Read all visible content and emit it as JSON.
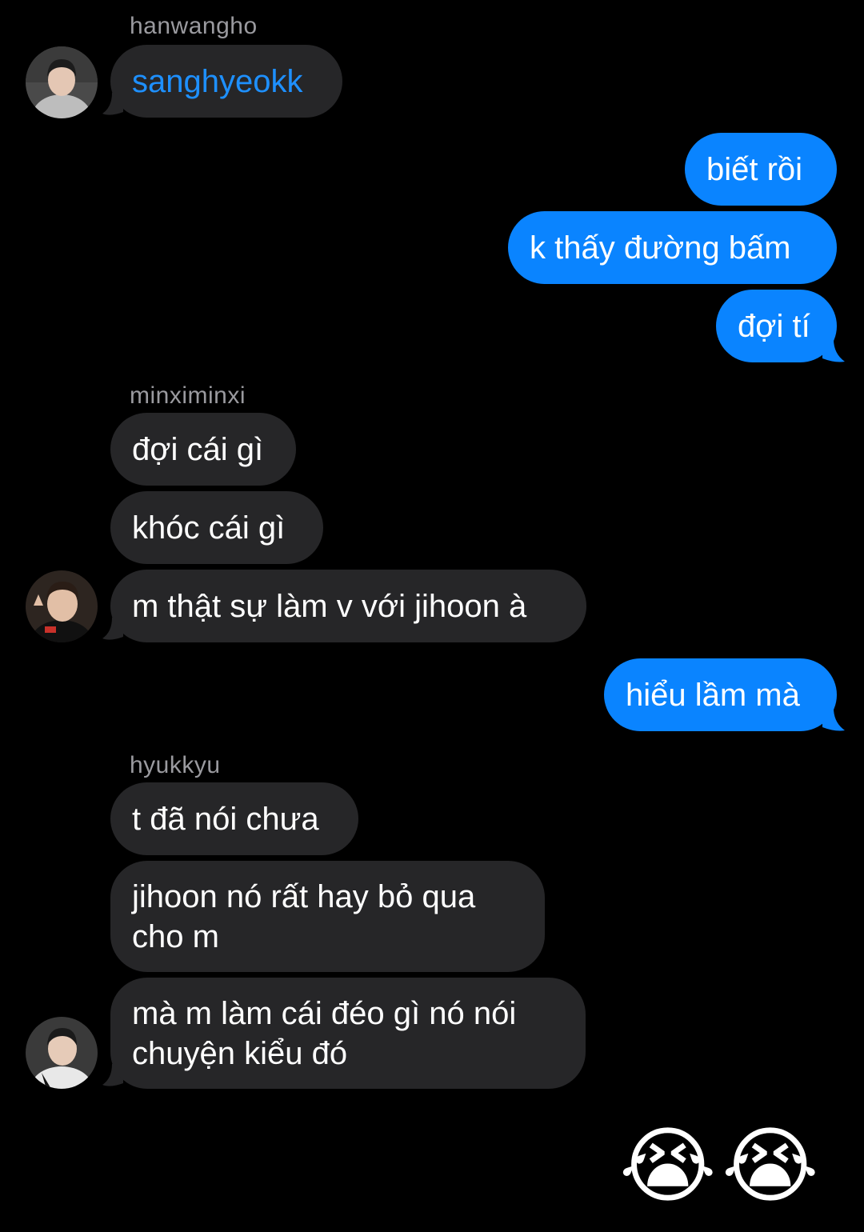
{
  "groups": [
    {
      "sender": "hanwangho",
      "messages": [
        "sanghyeokk"
      ]
    },
    {
      "sender": "me",
      "messages": [
        "biết rồi",
        "k thấy đường bấm",
        "đợi tí"
      ]
    },
    {
      "sender": "minximinxi",
      "messages": [
        "đợi cái gì",
        "khóc cái gì",
        "m thật sự làm v với jihoon à"
      ]
    },
    {
      "sender": "me",
      "messages": [
        "hiểu lầm mà"
      ]
    },
    {
      "sender": "hyukkyu",
      "messages": [
        "t đã nói chưa",
        "jihoon nó rất hay bỏ qua cho m",
        "mà m làm cái đéo gì nó nói chuyện kiểu đó"
      ]
    }
  ],
  "final_emojis": [
    "😭",
    "😭"
  ],
  "colors": {
    "background": "#000000",
    "incoming_bubble": "#262628",
    "outgoing_bubble": "#0a84ff",
    "mention": "#1e90ff",
    "sender_label": "#9a9a9f"
  },
  "avatars": [
    "avatar-hanwangho",
    "avatar-minximinxi",
    "avatar-hyukkyu"
  ]
}
